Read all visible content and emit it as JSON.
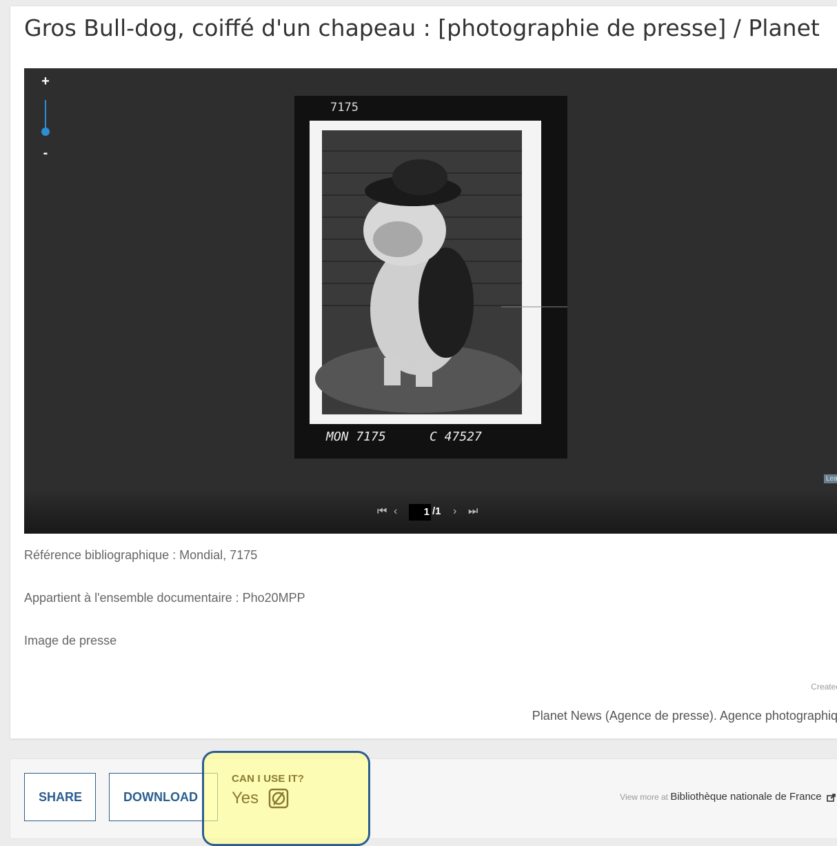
{
  "title": "Gros Bull-dog, coiffé d'un chapeau : [photographie de presse] / Planet",
  "viewer": {
    "zoom_in": "+",
    "zoom_out": "-",
    "attribution": "Leaflet",
    "pager": {
      "first": "⏮",
      "prev": "‹",
      "current": "1",
      "sep": "/1",
      "next": "›",
      "last": "⏭"
    },
    "photo_markings": {
      "top": "7175",
      "bottom_left": "MON 7175",
      "bottom_right": "C 47527"
    }
  },
  "metadata": {
    "reference": "Référence bibliographique : Mondial, 7175",
    "collection": "Appartient à l'ensemble documentaire : Pho20MPP",
    "type": "Image de presse",
    "created_by_label": "Created by",
    "creator": "Planet News (Agence de presse). Agence photographique"
  },
  "footer": {
    "share_label": "SHARE",
    "download_label": "DOWNLOAD",
    "can_use_label": "CAN I USE IT?",
    "can_use_value": "Yes",
    "view_more_prefix": "View more at",
    "view_more_link": "Bibliothèque nationale de France"
  },
  "colors": {
    "accent": "#2a5d8f",
    "zoom_blue": "#2b8fd3",
    "highlight": "#ffff8c"
  },
  "icons": {
    "public_domain": "public-domain-icon",
    "external_link": "external-link-icon"
  }
}
